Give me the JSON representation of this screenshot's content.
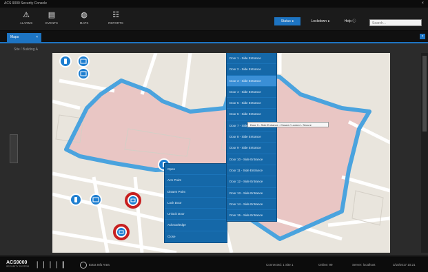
{
  "window": {
    "title": "ACS 9000 Security Console",
    "close_glyph": "×"
  },
  "toolbar": {
    "items": [
      {
        "label": "ALARMS",
        "icon": "alarm-icon",
        "glyph": "⚠"
      },
      {
        "label": "EVENTS",
        "icon": "events-icon",
        "glyph": "▤"
      },
      {
        "label": "MAPS",
        "icon": "map-icon",
        "glyph": "◍"
      },
      {
        "label": "REPORTS",
        "icon": "reports-icon",
        "glyph": "☷"
      }
    ],
    "buttons": [
      {
        "label": "Status ●",
        "active": true
      },
      {
        "label": "Lockdown ●",
        "active": false
      },
      {
        "label": "Help ⓘ",
        "active": false
      }
    ],
    "search_placeholder": "Search..."
  },
  "tabs": [
    {
      "label": "Maps",
      "close": "×"
    }
  ],
  "tab_close": "×",
  "breadcrumb": "Site / Building A",
  "map": {
    "context_menu": {
      "items": [
        "Open",
        "Arm Point",
        "Disarm Point",
        "Lock Door",
        "Unlock Door",
        "Acknowledge",
        "Close"
      ]
    },
    "door_menu": {
      "items": [
        "Door 1 - Side Entrance",
        "Door 2 - Side Entrance",
        "Door 3 - Side Entrance",
        "Door 4 - Side Entrance",
        "Door 5 - Side Entrance",
        "Door 6 - Side Entrance",
        "Door 7 - Side Entrance",
        "Door 8 - Side Entrance",
        "Door 9 - Side Entrance",
        "Door 10 - Side Entrance",
        "Door 11 - Side Entrance",
        "Door 12 - Side Entrance",
        "Door 13 - Side Entrance",
        "Door 14 - Side Entrance",
        "Door 15 - Side Entrance"
      ],
      "selected_index": 2
    },
    "tooltip": "Door 3 - Side Entrance : Closed / Locked - Secure",
    "colors": {
      "boundary": "#4aa3de",
      "building": "#e9c6c4",
      "roads": "#ffffff",
      "alarm_ring": "#c71f1f",
      "marker": "#1d7ed0"
    }
  },
  "statusbar": {
    "logo": "ACS9000",
    "logo_sub": "SECURITY SYSTEM",
    "bars": "❘❘❘❘❙",
    "extension_label": "Extra Info Area",
    "status_items": [
      "Connected: 1 Site 1",
      "Online: 99",
      "Server: localhost",
      "3/18/2017 10:21"
    ]
  }
}
